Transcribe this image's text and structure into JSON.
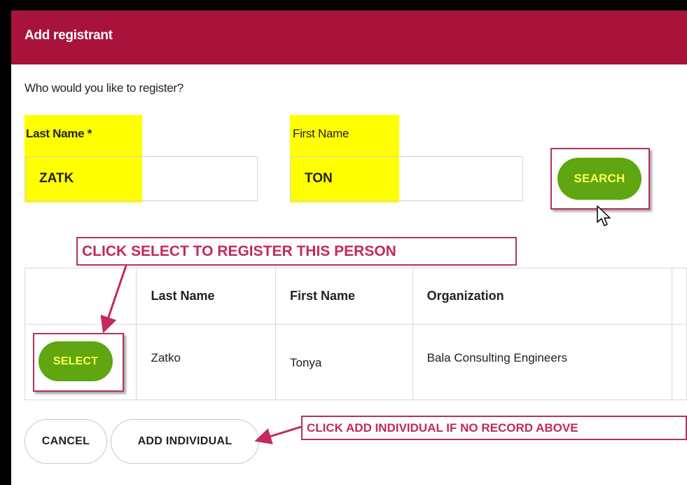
{
  "dialog": {
    "title": "Add registrant",
    "prompt": "Who would you like to register?"
  },
  "form": {
    "last_name_label": "Last Name",
    "required_mark": "*",
    "last_name_value": "ZATK",
    "first_name_label": "First Name",
    "first_name_value": "TON",
    "search_label": "SEARCH"
  },
  "table": {
    "headers": [
      "",
      "Last Name",
      "First Name",
      "Organization",
      ""
    ],
    "rows": [
      {
        "select_label": "SELECT",
        "last_name": "Zatko",
        "first_name": "Tonya",
        "organization": "Bala Consulting Engineers"
      }
    ]
  },
  "footer": {
    "cancel_label": "CANCEL",
    "add_individual_label": "ADD INDIVIDUAL"
  },
  "annotations": {
    "select_callout": "CLICK SELECT TO REGISTER THIS PERSON",
    "add_callout": "CLICK ADD INDIVIDUAL IF NO RECORD ABOVE",
    "highlight_color": "#ffff00",
    "callout_color": "#b2335f",
    "brand_color": "#a8123b",
    "button_color": "#5fa611"
  }
}
